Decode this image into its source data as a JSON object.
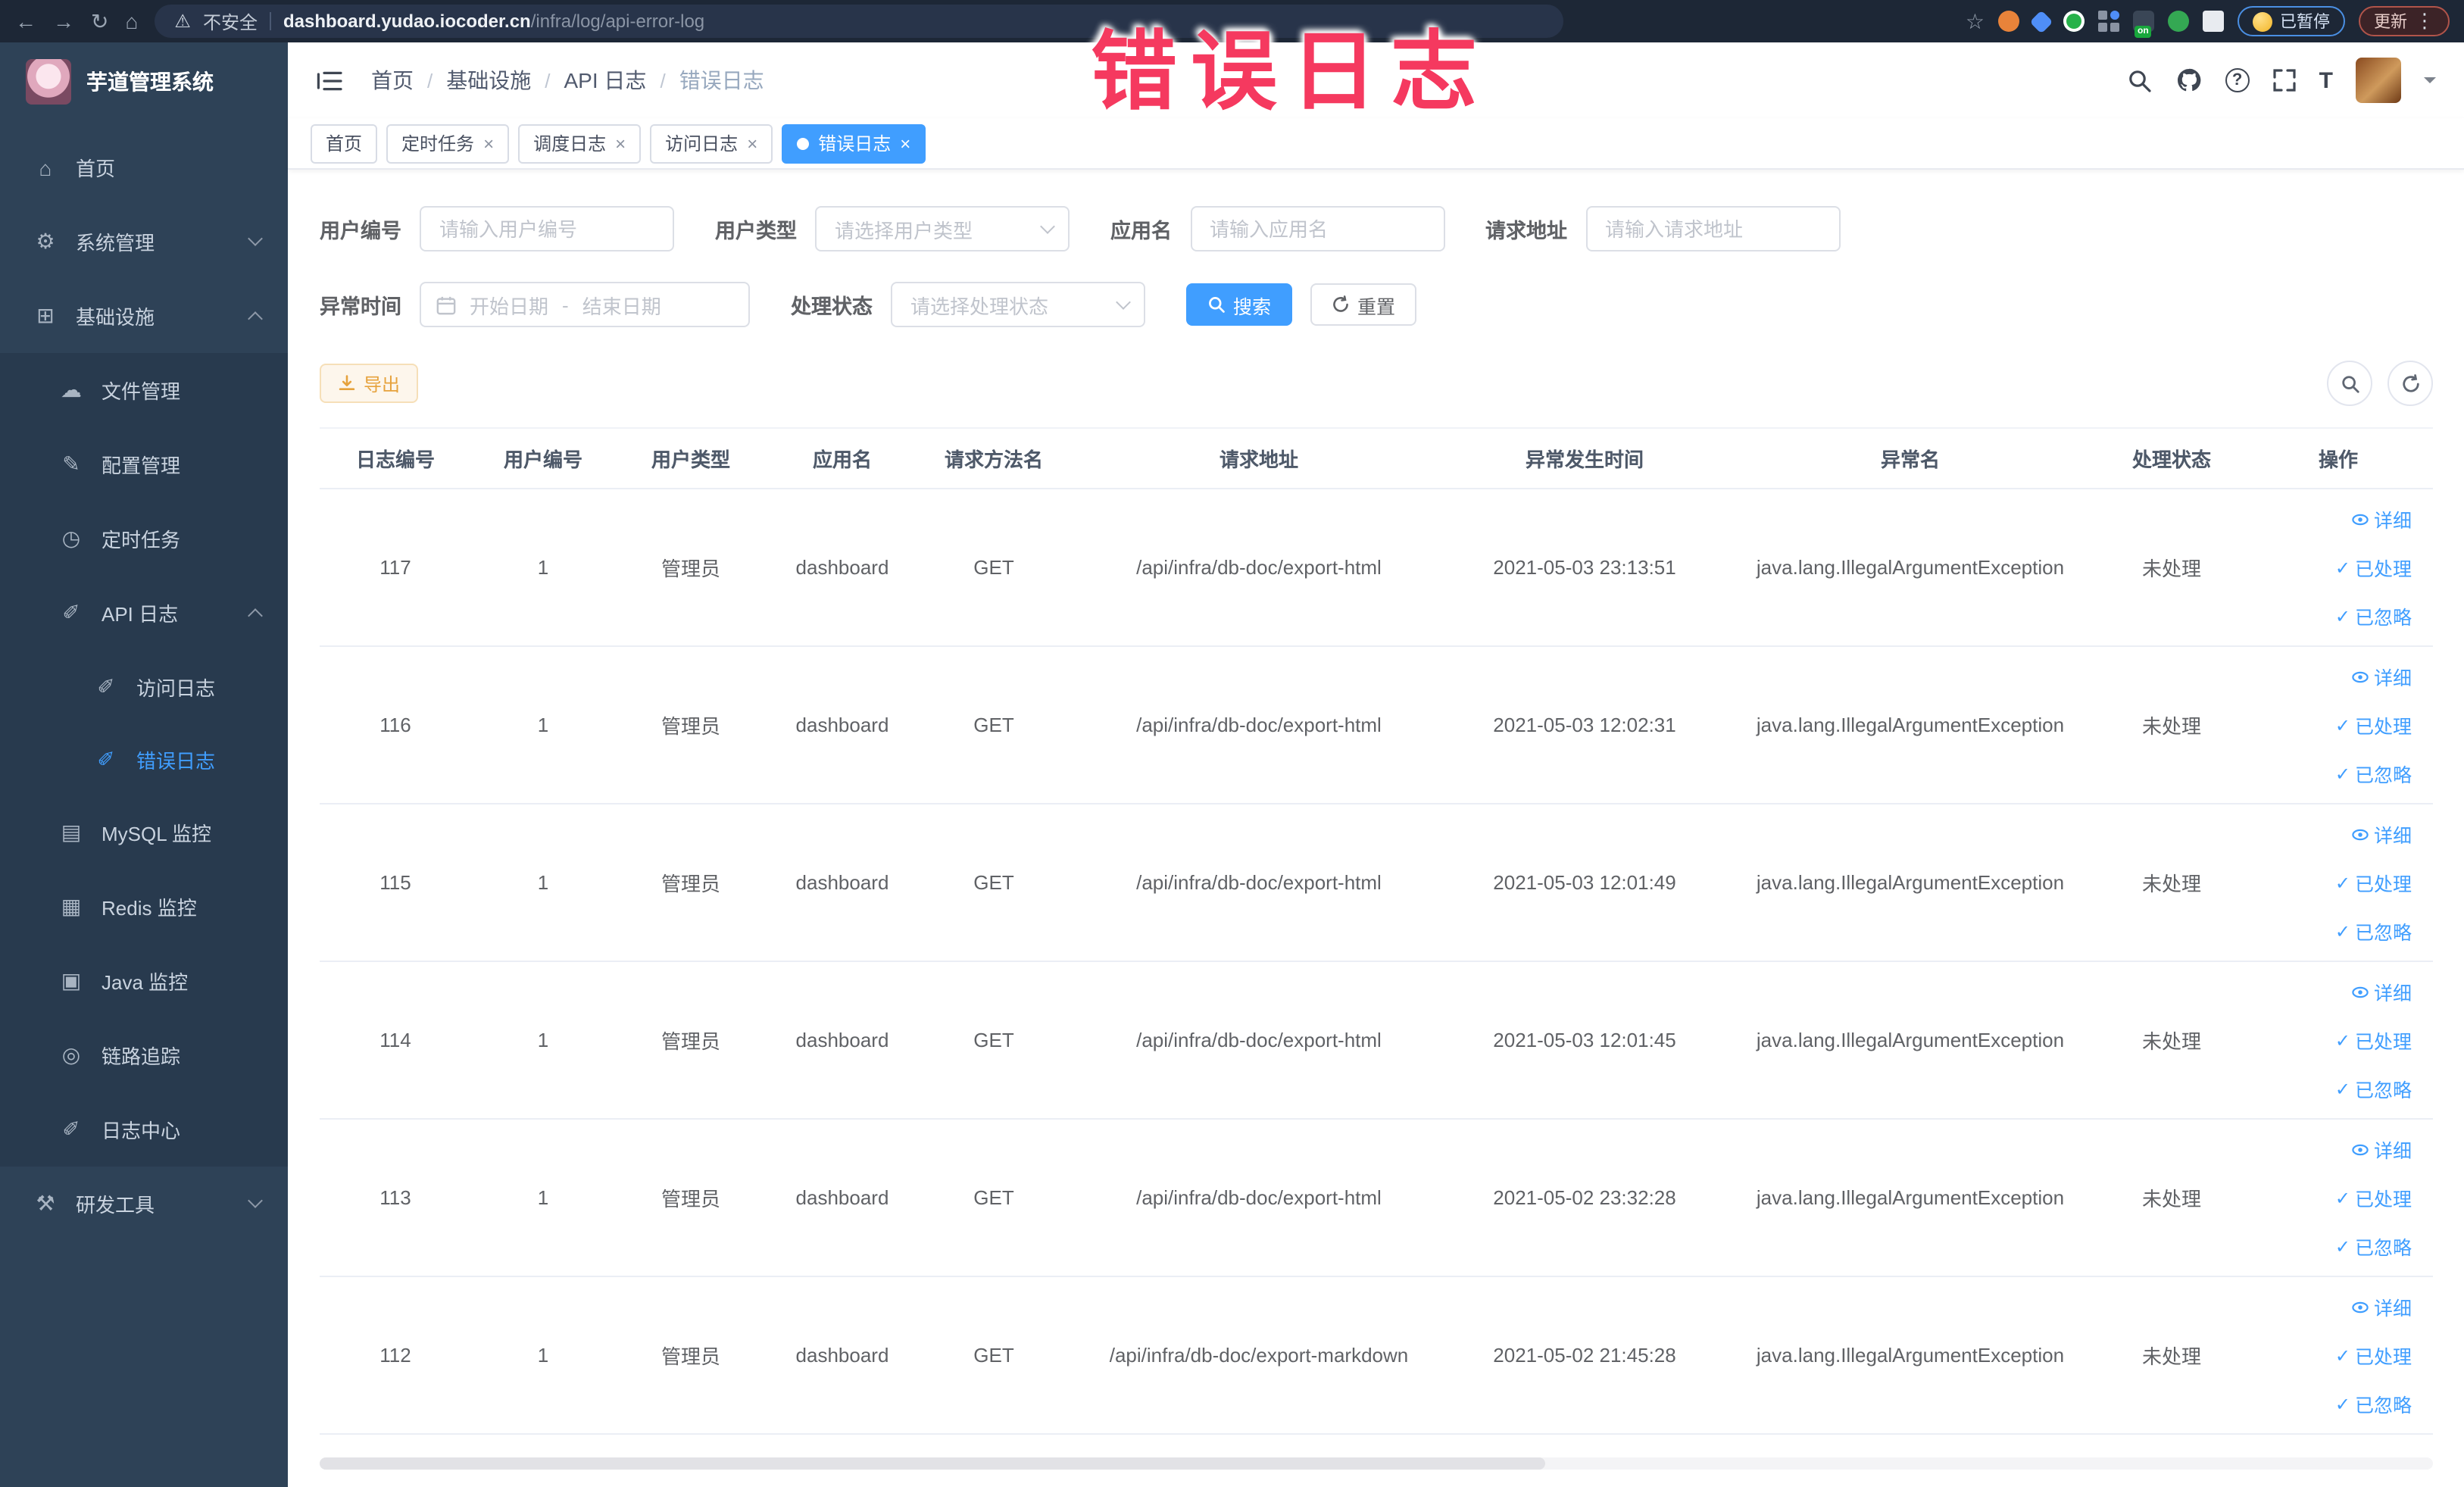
{
  "browser": {
    "security_label": "不安全",
    "url_domain": "dashboard.yudao.iocoder.cn",
    "url_path": "/infra/log/api-error-log",
    "paused_badge": "已暂停",
    "update_badge": "更新",
    "extension_on_badge": "on"
  },
  "watermark": {
    "text": "错误日志",
    "color": "#f5395f"
  },
  "icons": {
    "back": "←",
    "forward": "→",
    "reload": "↻",
    "home": "⌂",
    "warning": "⚠",
    "star": "☆",
    "dots": "⋮",
    "question_glyph": "?",
    "font_size_glyph": "T"
  },
  "sidebar": {
    "title": "芋道管理系统",
    "items": {
      "home": {
        "label": "首页",
        "icon": "⌂"
      },
      "system": {
        "label": "系统管理",
        "icon": "⚙"
      },
      "infra": {
        "label": "基础设施",
        "icon": "⊞"
      },
      "file": {
        "label": "文件管理",
        "icon": "☁"
      },
      "config": {
        "label": "配置管理",
        "icon": "✎"
      },
      "job": {
        "label": "定时任务",
        "icon": "◷"
      },
      "apilog": {
        "label": "API 日志",
        "icon": "✐"
      },
      "accesslog": {
        "label": "访问日志",
        "icon": "✐"
      },
      "errorlog": {
        "label": "错误日志",
        "icon": "✐"
      },
      "mysql": {
        "label": "MySQL 监控",
        "icon": "▤"
      },
      "redis": {
        "label": "Redis 监控",
        "icon": "▦"
      },
      "java": {
        "label": "Java 监控",
        "icon": "▣"
      },
      "trace": {
        "label": "链路追踪",
        "icon": "◎"
      },
      "logcenter": {
        "label": "日志中心",
        "icon": "✐"
      },
      "devtools": {
        "label": "研发工具",
        "icon": "⚒"
      }
    }
  },
  "breadcrumb": {
    "sep": "/",
    "items": [
      "首页",
      "基础设施",
      "API 日志",
      "错误日志"
    ]
  },
  "tabs": {
    "home": "首页",
    "job": "定时任务",
    "joblog": "调度日志",
    "accesslog": "访问日志",
    "errorlog": "错误日志",
    "close": "×"
  },
  "filters": {
    "user_id_label": "用户编号",
    "user_id_placeholder": "请输入用户编号",
    "user_type_label": "用户类型",
    "user_type_placeholder": "请选择用户类型",
    "app_name_label": "应用名",
    "app_name_placeholder": "请输入应用名",
    "request_url_label": "请求地址",
    "request_url_placeholder": "请输入请求地址",
    "time_label": "异常时间",
    "time_start_placeholder": "开始日期",
    "time_separator": "-",
    "time_end_placeholder": "结束日期",
    "status_label": "处理状态",
    "status_placeholder": "请选择处理状态",
    "search_button": "搜索",
    "reset_button": "重置",
    "export_button": "导出"
  },
  "table": {
    "columns": [
      "日志编号",
      "用户编号",
      "用户类型",
      "应用名",
      "请求方法名",
      "请求地址",
      "异常发生时间",
      "异常名",
      "处理状态",
      "操作"
    ],
    "action_labels": {
      "detail": "详细",
      "processed": "已处理",
      "ignored": "已忽略"
    },
    "check_glyph": "✓",
    "rows": [
      {
        "log_id": "117",
        "user_id": "1",
        "user_type": "管理员",
        "app_name": "dashboard",
        "method": "GET",
        "url": "/api/infra/db-doc/export-html",
        "time": "2021-05-03 23:13:51",
        "exception": "java.lang.IllegalArgumentException",
        "status": "未处理"
      },
      {
        "log_id": "116",
        "user_id": "1",
        "user_type": "管理员",
        "app_name": "dashboard",
        "method": "GET",
        "url": "/api/infra/db-doc/export-html",
        "time": "2021-05-03 12:02:31",
        "exception": "java.lang.IllegalArgumentException",
        "status": "未处理"
      },
      {
        "log_id": "115",
        "user_id": "1",
        "user_type": "管理员",
        "app_name": "dashboard",
        "method": "GET",
        "url": "/api/infra/db-doc/export-html",
        "time": "2021-05-03 12:01:49",
        "exception": "java.lang.IllegalArgumentException",
        "status": "未处理"
      },
      {
        "log_id": "114",
        "user_id": "1",
        "user_type": "管理员",
        "app_name": "dashboard",
        "method": "GET",
        "url": "/api/infra/db-doc/export-html",
        "time": "2021-05-03 12:01:45",
        "exception": "java.lang.IllegalArgumentException",
        "status": "未处理"
      },
      {
        "log_id": "113",
        "user_id": "1",
        "user_type": "管理员",
        "app_name": "dashboard",
        "method": "GET",
        "url": "/api/infra/db-doc/export-html",
        "time": "2021-05-02 23:32:28",
        "exception": "java.lang.IllegalArgumentException",
        "status": "未处理"
      },
      {
        "log_id": "112",
        "user_id": "1",
        "user_type": "管理员",
        "app_name": "dashboard",
        "method": "GET",
        "url": "/api/infra/db-doc/export-markdown",
        "time": "2021-05-02 21:45:28",
        "exception": "java.lang.IllegalArgumentException",
        "status": "未处理"
      }
    ]
  },
  "colors": {
    "accent": "#409eff",
    "sidebar_bg": "#2e4257",
    "chrome_bg": "#1d2736",
    "export": "#e6a23c"
  }
}
